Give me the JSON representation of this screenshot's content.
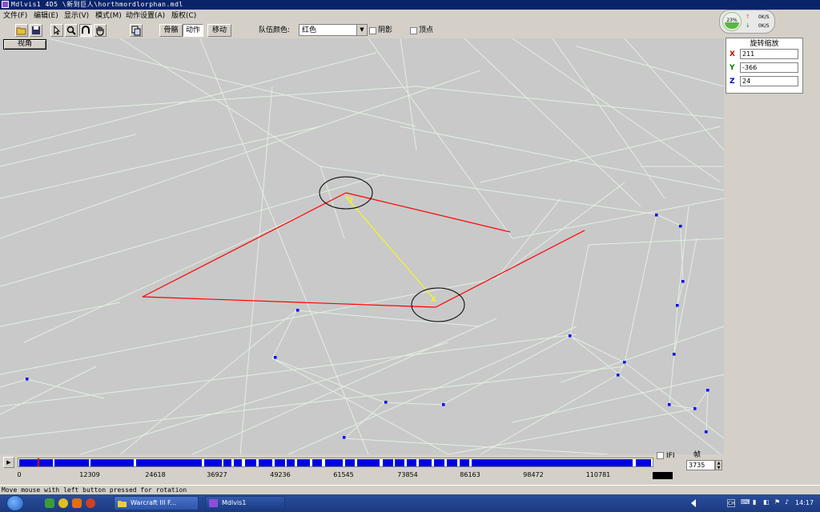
{
  "window": {
    "title": "Mdlvis1 4D5 \\新到巨人\\horthmordlorphan.mdl"
  },
  "menu": [
    "文件(F)",
    "编辑(E)",
    "显示(V)",
    "模式(M)",
    "动作设置(A)",
    "版权(C)"
  ],
  "toolbar": {
    "tabs": [
      "骨骼",
      "动作",
      "移动"
    ],
    "active_tab": "动作",
    "team_color_label": "队伍颜色:",
    "team_color_value": "红色",
    "shadow_label": "阴影",
    "vertex_label": "顶点",
    "view_button": "视角"
  },
  "rotation_panel": {
    "title": "旋转缩放",
    "axes": [
      {
        "axis": "X",
        "value": "211",
        "color": "#d00000"
      },
      {
        "axis": "Y",
        "value": "-366",
        "color": "#008000"
      },
      {
        "axis": "Z",
        "value": "24",
        "color": "#0000d0"
      }
    ]
  },
  "network_widget": {
    "cpu": "23%",
    "up": "0K/S",
    "down": "0K/S"
  },
  "timeline": {
    "ticks": [
      "0",
      "12309",
      "24618",
      "36927",
      "49236",
      "61545",
      "73854",
      "86163",
      "98472",
      "110781"
    ],
    "ifi_label": "IFI",
    "frame_label": "帧",
    "frame_value": "3735",
    "play_icon": "play-icon"
  },
  "status": {
    "text": "Move mouse with left button pressed for rotation"
  },
  "taskbar": {
    "buttons": [
      "Warcraft III F...",
      "Mdlvis1"
    ],
    "ime": "CH",
    "clock": "14:17"
  },
  "colors": {
    "selection": "#ff0000",
    "bone_link": "#ffff00",
    "wire": "#e8f4e8",
    "vertex": "#0000ff",
    "track": "#0000e6"
  }
}
